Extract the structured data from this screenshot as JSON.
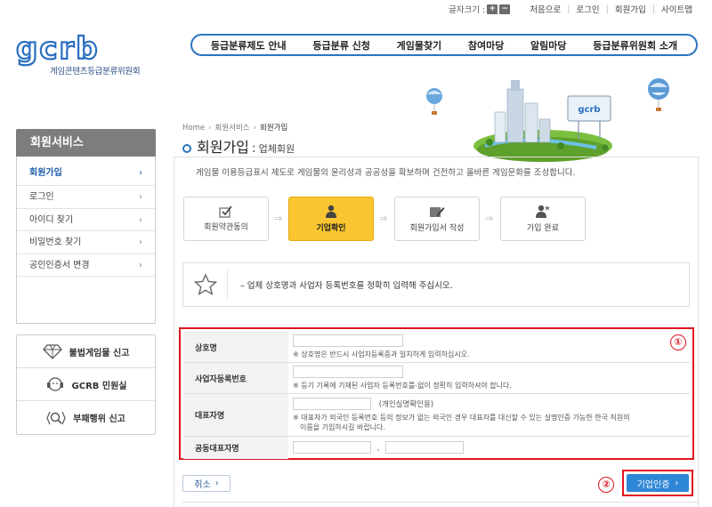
{
  "topbar": {
    "fontsize_label": "글자크기 :",
    "plus": "+",
    "minus": "−",
    "links": [
      "처음으로",
      "로그인",
      "회원가입",
      "사이트맵"
    ]
  },
  "logo": {
    "text": "gcrb",
    "sub": "게임콘텐츠등급분류위원회"
  },
  "gnb": [
    "등급분류제도 안내",
    "등급분류 신청",
    "게임물찾기",
    "참여마당",
    "알림마당",
    "등급분류위원회 소개"
  ],
  "deco": {
    "sign": "gcrb"
  },
  "lnb": {
    "title": "회원서비스",
    "items": [
      {
        "label": "회원가입",
        "active": true
      },
      {
        "label": "로그인"
      },
      {
        "label": "아이디 찾기"
      },
      {
        "label": "비밀번호 찾기"
      },
      {
        "label": "공인인증서 변경"
      }
    ]
  },
  "quick": [
    {
      "label": "불법게임물 신고",
      "icon": "diamond-icon"
    },
    {
      "label": "GCRB 민원실",
      "icon": "headset-icon"
    },
    {
      "label": "부패행위 신고",
      "icon": "magnifier-icon"
    }
  ],
  "breadcrumb": [
    "Home",
    "회원서비스",
    "회원가입"
  ],
  "title": {
    "main": "회원가입",
    "colon": ":",
    "sub": "업체회원"
  },
  "intro": "게임물 이용등급표시 제도로 게임물의 윤리성과 공공성을 확보하며 건전하고 올바른 게임문화를 조성합니다.",
  "steps": [
    {
      "label": "회원약관동의",
      "icon": "check-icon"
    },
    {
      "label": "기업확인",
      "icon": "person-icon",
      "active": true
    },
    {
      "label": "회원가입서 작성",
      "icon": "pencil-icon"
    },
    {
      "label": "가입 완료",
      "icon": "person-star-icon"
    }
  ],
  "notice": "–  업체 상호명과 사업자 등록번호를 정확히 입력해 주십시오.",
  "form": {
    "rows": [
      {
        "label": "상호명",
        "hint": "※ 상호명은 반드시 사업자등록증과 일치하게 입력하십시오."
      },
      {
        "label": "사업자등록번호",
        "hint": "※ 등기 기록에 기재된 사업자 등록번호를-없이 정확히 입력하셔야 합니다."
      },
      {
        "label": "대표자명",
        "field_note": "(개인실명확인용)",
        "hint1": "※ 대표자가 외국인 등록번호 등의 정보가 없는 외국인 경우 대표자를 대신할 수 있는 실명인증 가능한 한국 직원의",
        "hint2": "이름을 기입하시길 바랍니다."
      },
      {
        "label": "공동대표자명",
        "separator": ","
      }
    ]
  },
  "markers": [
    "①",
    "②"
  ],
  "buttons": {
    "cancel": "취소",
    "biz_auth": "기업인증",
    "arrow": "›"
  },
  "colors": {
    "brand_blue": "#2d74bf",
    "highlight_red": "#e0141f",
    "step_active": "#f9c530",
    "button_blue": "#2e86d6"
  }
}
